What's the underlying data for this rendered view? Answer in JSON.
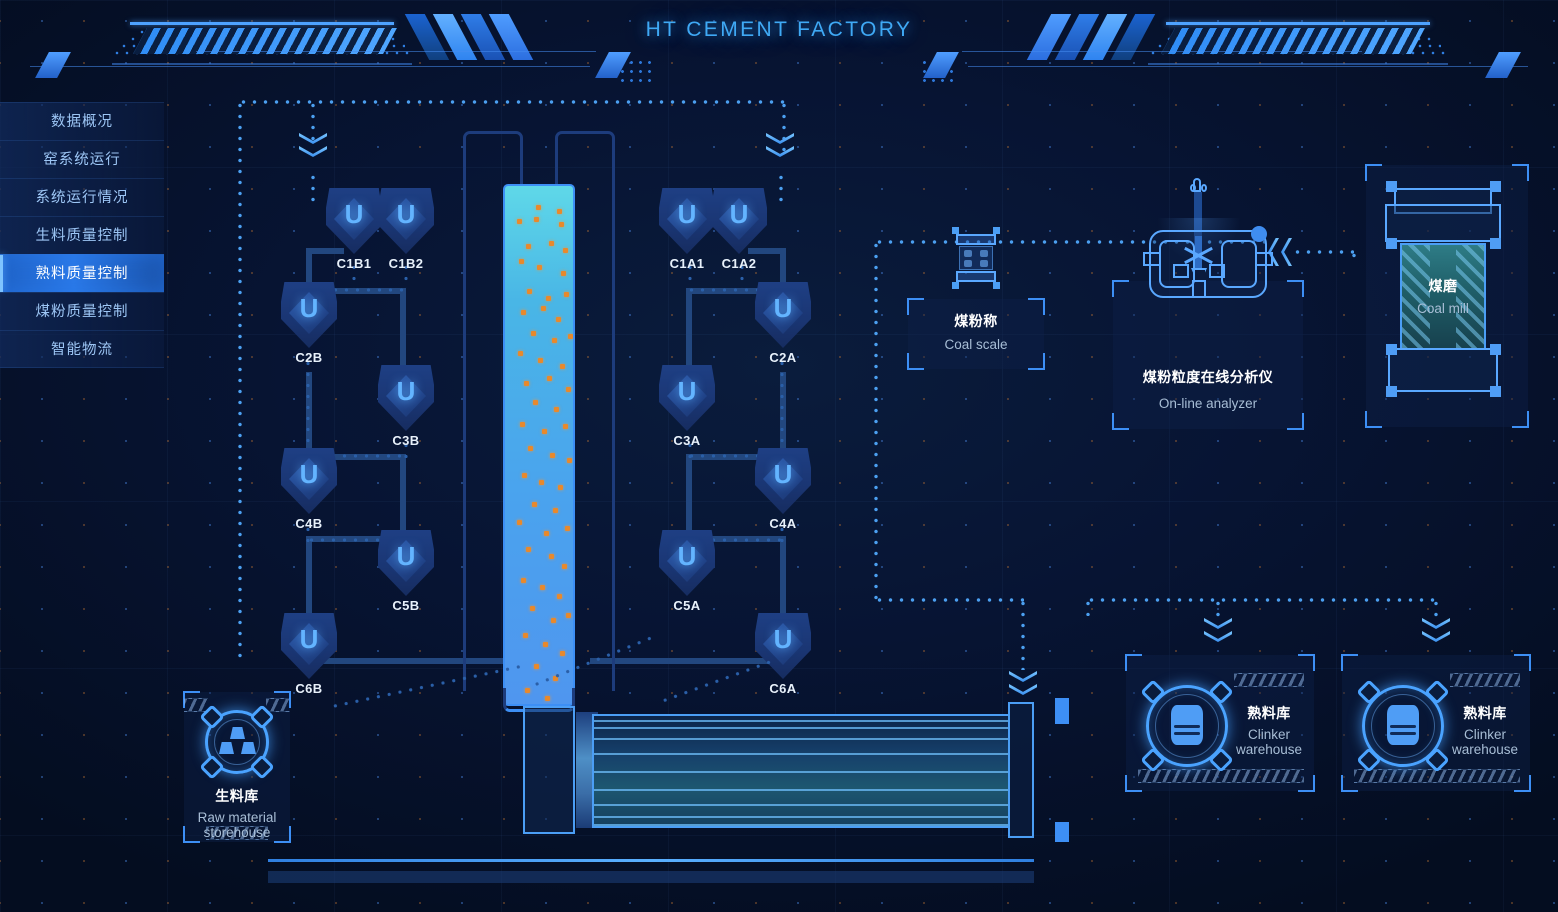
{
  "header": {
    "title": "HT CEMENT FACTORY"
  },
  "sidebar": {
    "items": [
      {
        "label": "数据概况",
        "active": false
      },
      {
        "label": "窑系统运行",
        "active": false
      },
      {
        "label": "系统运行情况",
        "active": false
      },
      {
        "label": "生料质量控制",
        "active": false
      },
      {
        "label": "熟料质量控制",
        "active": true
      },
      {
        "label": "煤粉质量控制",
        "active": false
      },
      {
        "label": "智能物流",
        "active": false
      }
    ]
  },
  "diagram": {
    "cyclones_left": [
      "C1B1",
      "C1B2",
      "C2B",
      "C3B",
      "C4B",
      "C5B",
      "C6B"
    ],
    "cyclones_right": [
      "C1A1",
      "C1A2",
      "C2A",
      "C3A",
      "C4A",
      "C5A",
      "C6A"
    ],
    "cyclone_glyph": "U",
    "equipment": {
      "coal_scale": {
        "cn": "煤粉称",
        "en": "Coal scale"
      },
      "online_analyzer": {
        "cn": "煤粉粒度在线分析仪",
        "en": "On-line analyzer"
      },
      "coal_mill": {
        "cn": "煤磨",
        "en": "Coal mill"
      },
      "raw_storehouse": {
        "cn": "生料库",
        "en": "Raw material storehouse"
      },
      "clinker_1": {
        "cn": "熟料库",
        "en": "Clinker warehouse"
      },
      "clinker_2": {
        "cn": "熟料库",
        "en": "Clinker warehouse"
      }
    }
  },
  "colors": {
    "accent": "#3fa9f5",
    "accent_alt": "#5aa8ff",
    "background": "#050f24",
    "panel": "#0e224a",
    "active_nav": "#2a79e8",
    "particle": "#e8892c",
    "mill_body": "#2e7c86"
  }
}
